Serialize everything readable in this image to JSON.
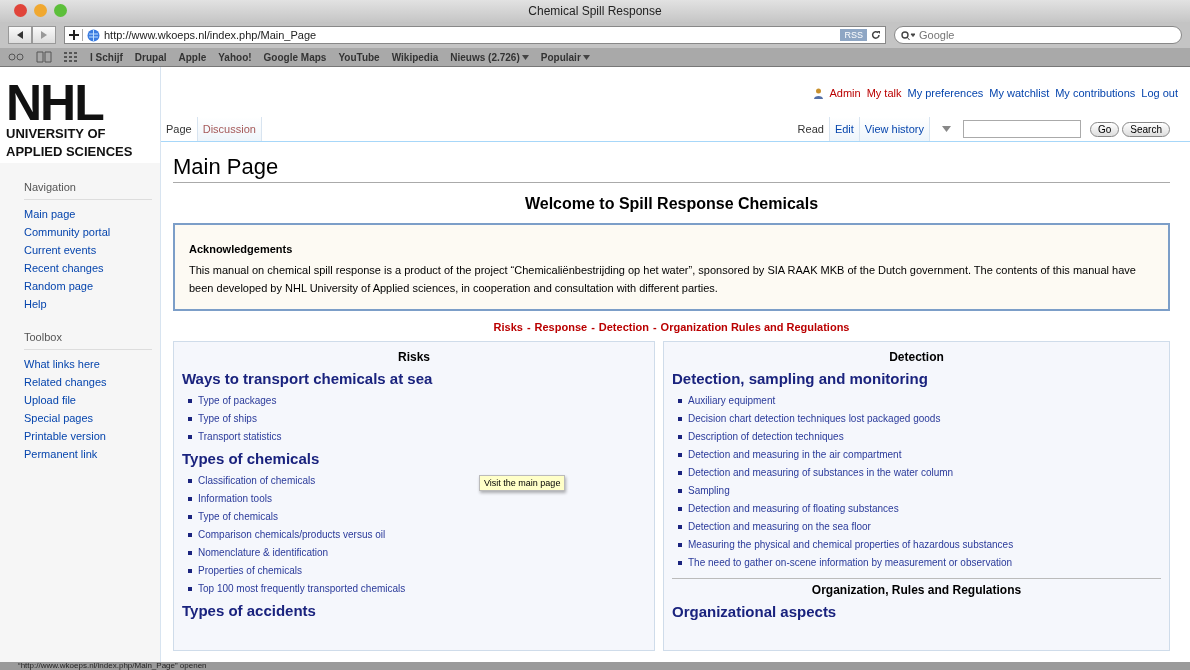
{
  "browser": {
    "title": "Chemical Spill Response",
    "url": "http://www.wkoeps.nl/index.php/Main_Page",
    "rss": "RSS",
    "search_placeholder": "Google",
    "bookmarks": [
      {
        "label": "I Schijf",
        "menu": false
      },
      {
        "label": "Drupal",
        "menu": false
      },
      {
        "label": "Apple",
        "menu": false
      },
      {
        "label": "Yahoo!",
        "menu": false
      },
      {
        "label": "Google Maps",
        "menu": false
      },
      {
        "label": "YouTube",
        "menu": false
      },
      {
        "label": "Wikipedia",
        "menu": false
      },
      {
        "label": "Nieuws (2.726)",
        "menu": true
      },
      {
        "label": "Populair",
        "menu": true
      }
    ],
    "status": "“http://www.wkoeps.nl/index.php/Main_Page” openen"
  },
  "logo": {
    "mark": "NHL",
    "line1": "UNIVERSITY OF",
    "line2": "APPLIED SCIENCES"
  },
  "personal_links": [
    {
      "label": "Admin",
      "new": true,
      "user": true
    },
    {
      "label": "My talk",
      "new": true,
      "user": false
    },
    {
      "label": "My preferences",
      "new": false,
      "user": false
    },
    {
      "label": "My watchlist",
      "new": false,
      "user": false
    },
    {
      "label": "My contributions",
      "new": false,
      "user": false
    },
    {
      "label": "Log out",
      "new": false,
      "user": false
    }
  ],
  "left_tabs": [
    {
      "label": "Page",
      "selected": true,
      "new": false
    },
    {
      "label": "Discussion",
      "selected": false,
      "new": true
    }
  ],
  "right_tabs": [
    {
      "label": "Read",
      "selected": true
    },
    {
      "label": "Edit",
      "selected": false
    },
    {
      "label": "View history",
      "selected": false
    }
  ],
  "search": {
    "go": "Go",
    "search": "Search"
  },
  "portals": [
    {
      "title": "Navigation",
      "items": [
        "Main page",
        "Community portal",
        "Current events",
        "Recent changes",
        "Random page",
        "Help"
      ]
    },
    {
      "title": "Toolbox",
      "items": [
        "What links here",
        "Related changes",
        "Upload file",
        "Special pages",
        "Printable version",
        "Permanent link"
      ]
    }
  ],
  "content": {
    "title": "Main Page",
    "welcome": "Welcome to Spill Response Chemicals",
    "acknowledgement": {
      "heading": "Acknowledgements",
      "text": "This manual on chemical spill response is a product of the project “Chemicaliënbestrijding op het water”, sponsored by SIA RAAK MKB of the Dutch government. The contents of this manual have been developed by NHL University of Applied sciences, in cooperation and consultation with different parties."
    },
    "section_links": [
      "Risks",
      "Response",
      "Detection",
      "Organization Rules and Regulations"
    ],
    "separator": "-",
    "columns": [
      {
        "blocks": [
          {
            "heading": "Risks",
            "sections": [
              {
                "title": "Ways to transport chemicals at sea",
                "items": [
                  "Type of packages",
                  "Type of ships",
                  "Transport statistics"
                ]
              },
              {
                "title": "Types of chemicals",
                "items": [
                  "Classification of chemicals",
                  "Information tools",
                  "Type of chemicals",
                  "Comparison chemicals/products versus oil",
                  "Nomenclature & identification",
                  "Properties of chemicals",
                  "Top 100 most frequently transported chemicals"
                ]
              },
              {
                "title": "Types of accidents"
              }
            ]
          }
        ]
      },
      {
        "blocks": [
          {
            "heading": "Detection",
            "sections": [
              {
                "title": "Detection, sampling and monitoring",
                "items": [
                  "Auxiliary equipment",
                  "Decision chart detection techniques lost packaged goods",
                  "Description of detection techniques",
                  "Detection and measuring in the air compartment",
                  "Detection and measuring of substances in the water column",
                  "Sampling",
                  "Detection and measuring of floating substances",
                  "Detection and measuring on the sea floor",
                  "Measuring the physical and chemical properties of hazardous substances",
                  "The need to gather on-scene information by measurement or observation"
                ]
              }
            ]
          },
          {
            "heading": "Organization, Rules and Regulations",
            "sections": [
              {
                "title": "Organizational aspects"
              }
            ]
          }
        ]
      }
    ]
  },
  "tooltip": "Visit the main page"
}
